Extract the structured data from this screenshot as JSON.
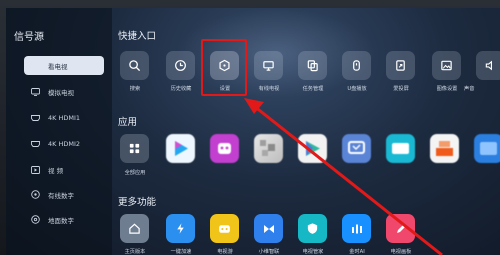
{
  "sidebar": {
    "title": "信号源",
    "items": [
      {
        "label": "看电视",
        "icon": "tv-icon",
        "active": true
      },
      {
        "label": "模拟电视",
        "icon": "analog-tv-icon"
      },
      {
        "label": "4K HDMI1",
        "icon": "hdmi-icon"
      },
      {
        "label": "4K HDMI2",
        "icon": "hdmi-icon"
      },
      {
        "label": "视    频",
        "icon": "video-icon"
      },
      {
        "label": "有线数字",
        "icon": "cable-icon"
      },
      {
        "label": "地面数字",
        "icon": "antenna-icon"
      }
    ]
  },
  "quick": {
    "title": "快捷入口",
    "items": [
      {
        "label": "搜索",
        "icon": "search-icon"
      },
      {
        "label": "历史收藏",
        "icon": "clock-icon"
      },
      {
        "label": "设置",
        "icon": "settings-icon"
      },
      {
        "label": "有线电视",
        "icon": "cable-tv-icon"
      },
      {
        "label": "任务管理",
        "icon": "task-icon"
      },
      {
        "label": "U盘播放",
        "icon": "usb-icon"
      },
      {
        "label": "爱投屏",
        "icon": "cast-icon"
      },
      {
        "label": "图像设置",
        "icon": "image-icon"
      },
      {
        "label": "声音",
        "icon": "sound-icon"
      }
    ]
  },
  "apps": {
    "title": "应用",
    "all_label": "全部应用",
    "colors": [
      "#20b3f0",
      "#d14fcf",
      "#8a2be2",
      "#2fb8a0",
      "#4d79d8",
      "#19c2d8",
      "#f05a1a",
      "#2a7fe0"
    ]
  },
  "more": {
    "title": "更多功能",
    "items": [
      {
        "label": "主页版本",
        "icon": "home-icon",
        "color": "#6f7d91"
      },
      {
        "label": "一键加速",
        "icon": "bolt-icon",
        "color": "#2b8ff0"
      },
      {
        "label": "电视游",
        "icon": "game-icon",
        "color": "#f0c419"
      },
      {
        "label": "小维智联",
        "icon": "link-icon",
        "color": "#2f80ed"
      },
      {
        "label": "电视管家",
        "icon": "shield-icon",
        "color": "#16b8c6"
      },
      {
        "label": "金时AI",
        "icon": "ai-icon",
        "color": "#1890ff"
      },
      {
        "label": "电视画板",
        "icon": "pen-icon",
        "color": "#f0476d"
      }
    ]
  }
}
